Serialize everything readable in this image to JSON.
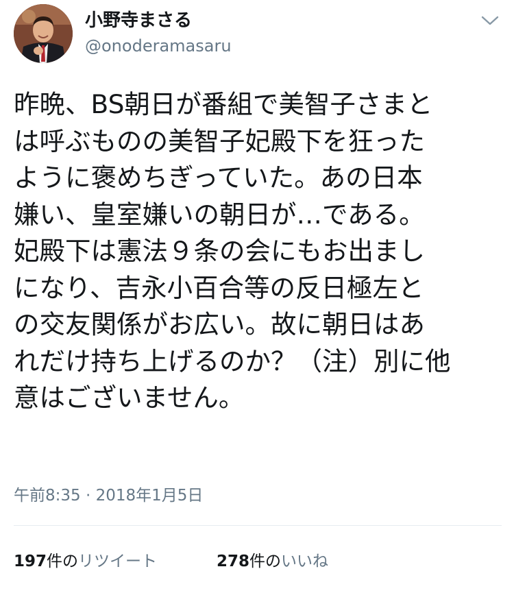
{
  "tweet": {
    "author": {
      "display_name": "小野寺まさる",
      "handle": "@onoderamasaru",
      "avatar_icon": "user-avatar"
    },
    "menu_icon": "chevron-down-icon",
    "text_lines": [
      "昨晩、BS朝日が番組で美智子さまと",
      "は呼ぶものの美智子妃殿下を狂った",
      "ように褒めちぎっていた。あの日本",
      "嫌い、皇室嫌いの朝日が…である。",
      "妃殿下は憲法９条の会にもお出まし",
      "になり、吉永小百合等の反日極左と",
      "の交友関係がお広い。故に朝日はあ",
      "れだけ持ち上げるのか？（注）別に他",
      "意はございません。"
    ],
    "timestamp": "午前8:35 · 2018年1月5日",
    "stats": {
      "retweets": {
        "count": "197",
        "unit": "件の",
        "label": "リツイート"
      },
      "likes": {
        "count": "278",
        "unit": "件の",
        "label": "いいね"
      }
    }
  },
  "colors": {
    "text": "#14171a",
    "secondary": "#657786",
    "divider": "#e6ecf0"
  }
}
